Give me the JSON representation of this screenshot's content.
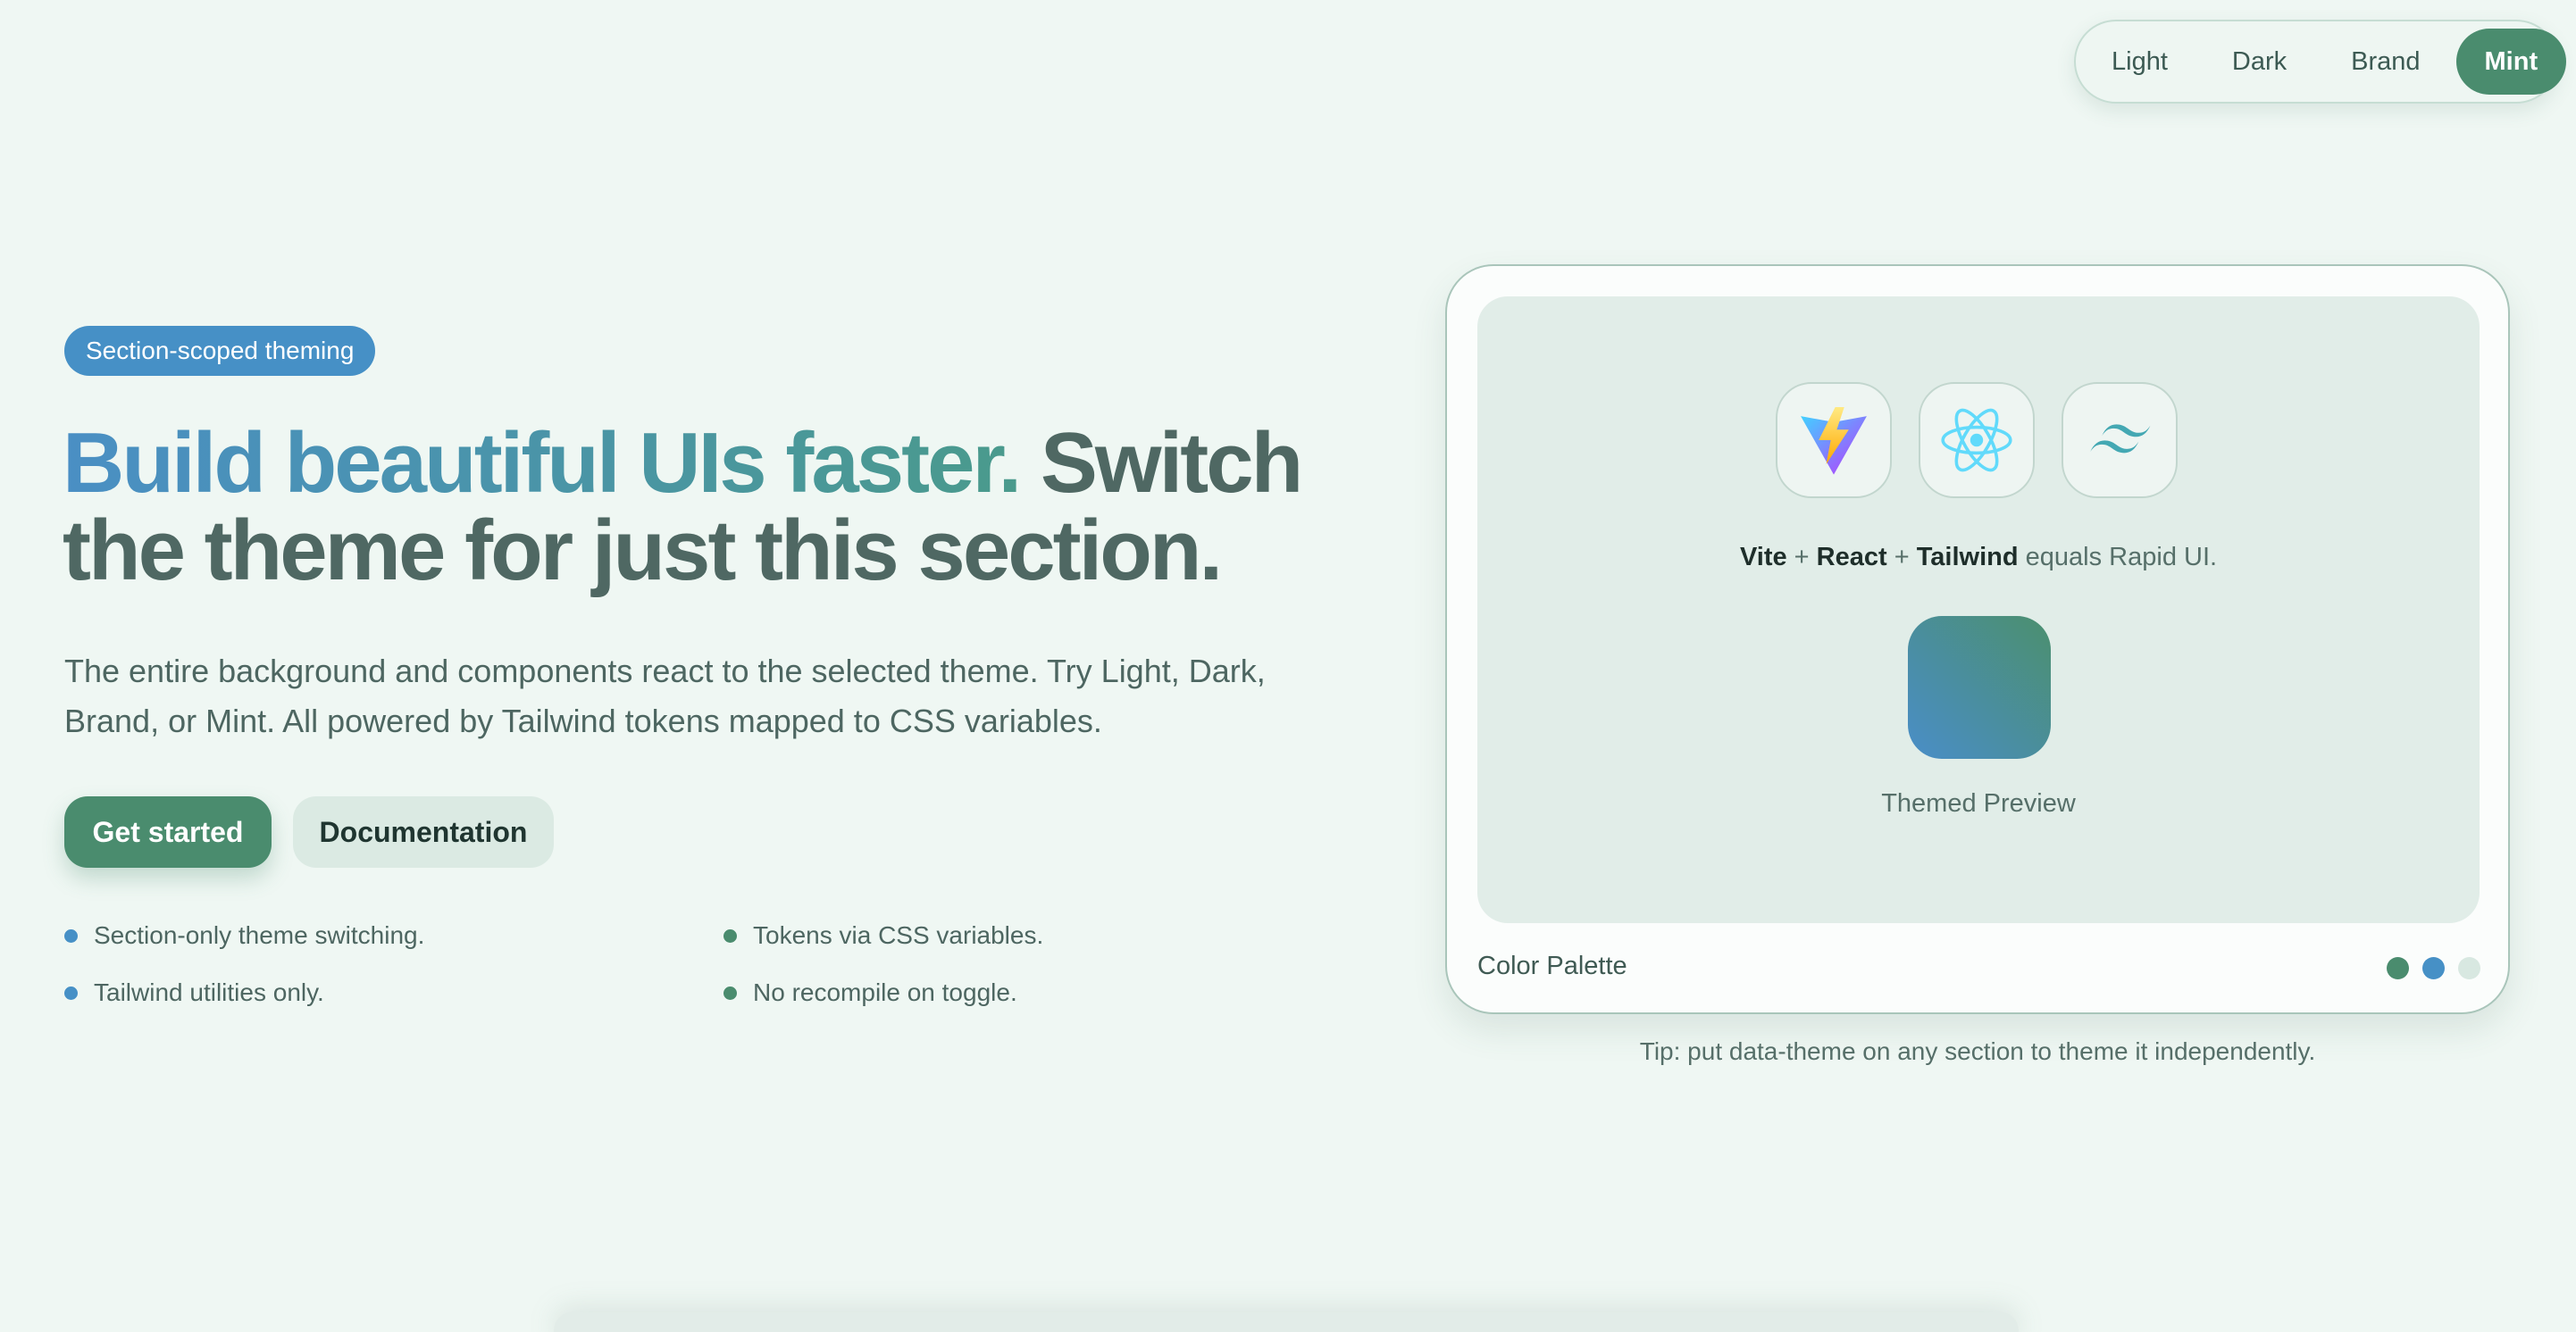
{
  "theme_switcher": {
    "options": [
      "Light",
      "Dark",
      "Brand",
      "Mint"
    ],
    "active": "Mint"
  },
  "hero": {
    "badge": "Section-scoped theming",
    "headline_accent": "Build beautiful UIs faster.",
    "headline_rest": "Switch the theme for just this section.",
    "lede": "The entire background and components react to the selected theme. Try Light, Dark, Brand, or Mint. All powered by Tailwind tokens mapped to CSS variables.",
    "primary_button": "Get started",
    "secondary_button": "Documentation",
    "features": [
      {
        "text": "Section-only theme switching.",
        "color": "#4690c6"
      },
      {
        "text": "Tokens via CSS variables.",
        "color": "#4a8c6e"
      },
      {
        "text": "Tailwind utilities only.",
        "color": "#4690c6"
      },
      {
        "text": "No recompile on toggle.",
        "color": "#4a8c6e"
      }
    ]
  },
  "preview": {
    "icons": [
      "vite-icon",
      "react-icon",
      "tailwind-icon"
    ],
    "stack": {
      "vite": "Vite",
      "plus1": "+",
      "react": "React",
      "plus2": "+",
      "tailwind": "Tailwind",
      "suffix": "equals Rapid UI."
    },
    "swatch_label": "Themed Preview",
    "palette_label": "Color Palette",
    "palette_colors": [
      "#4a8c6e",
      "#4690c6",
      "#d8e8e1"
    ]
  },
  "tip": "Tip: put data-theme on any section to theme it independently."
}
